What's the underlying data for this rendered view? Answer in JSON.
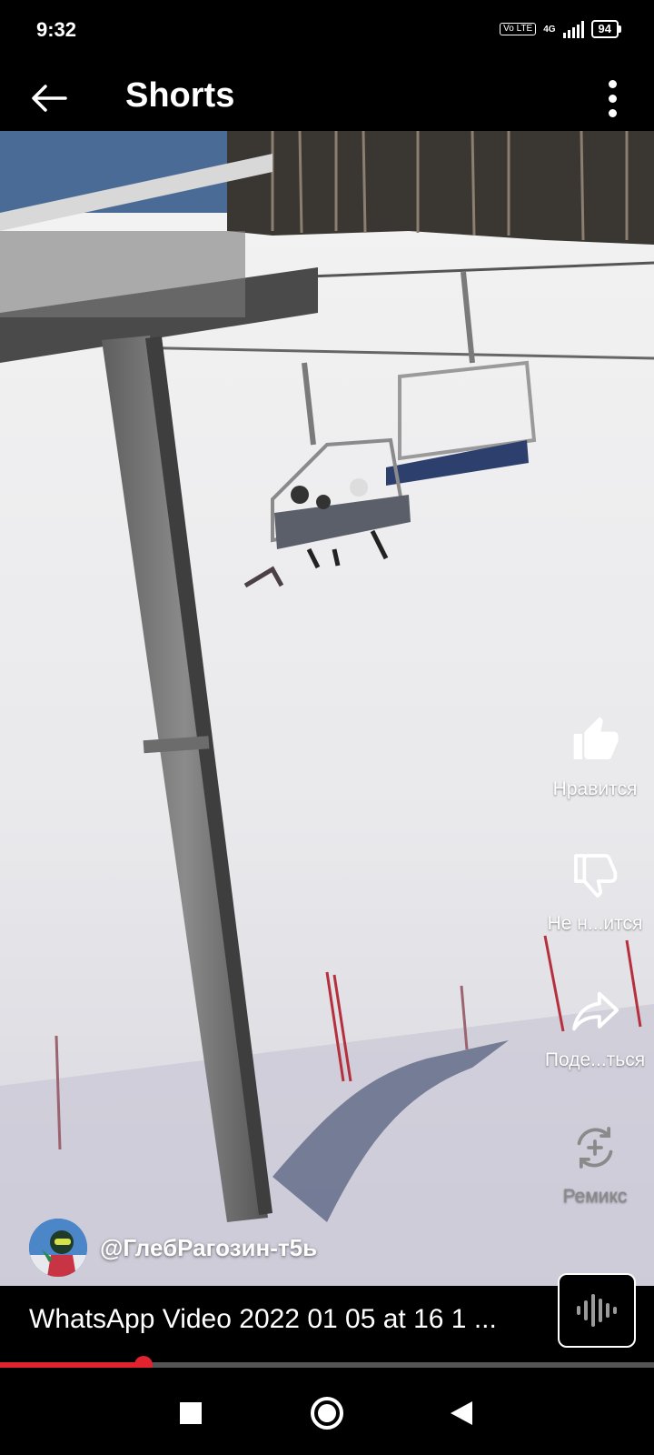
{
  "status_bar": {
    "time": "9:32",
    "volte_label": "Vo LTE",
    "network_label": "4G",
    "battery_level": "94"
  },
  "app_bar": {
    "title": "Shorts",
    "back_icon": "arrow-left-icon",
    "more_icon": "more-vertical-icon"
  },
  "actions": [
    {
      "label": "Нравится",
      "icon": "thumb-up-filled-icon",
      "enabled": true
    },
    {
      "label": "Не н...ится",
      "icon": "thumb-down-outline-icon",
      "enabled": true
    },
    {
      "label": "Поде...ться",
      "icon": "share-arrow-icon",
      "enabled": true
    },
    {
      "label": "Ремикс",
      "icon": "remix-icon",
      "enabled": false
    }
  ],
  "channel": {
    "name": "@ГлебРагозин-т5ь"
  },
  "video": {
    "title": "WhatsApp Video 2022 01 05 at 16 1 ...",
    "progress_fraction": 0.22
  },
  "colors": {
    "accent": "#e0232f",
    "background": "#000000"
  },
  "nav": {
    "recents_icon": "square-icon",
    "home_icon": "circle-icon",
    "back_icon": "triangle-back-icon"
  }
}
